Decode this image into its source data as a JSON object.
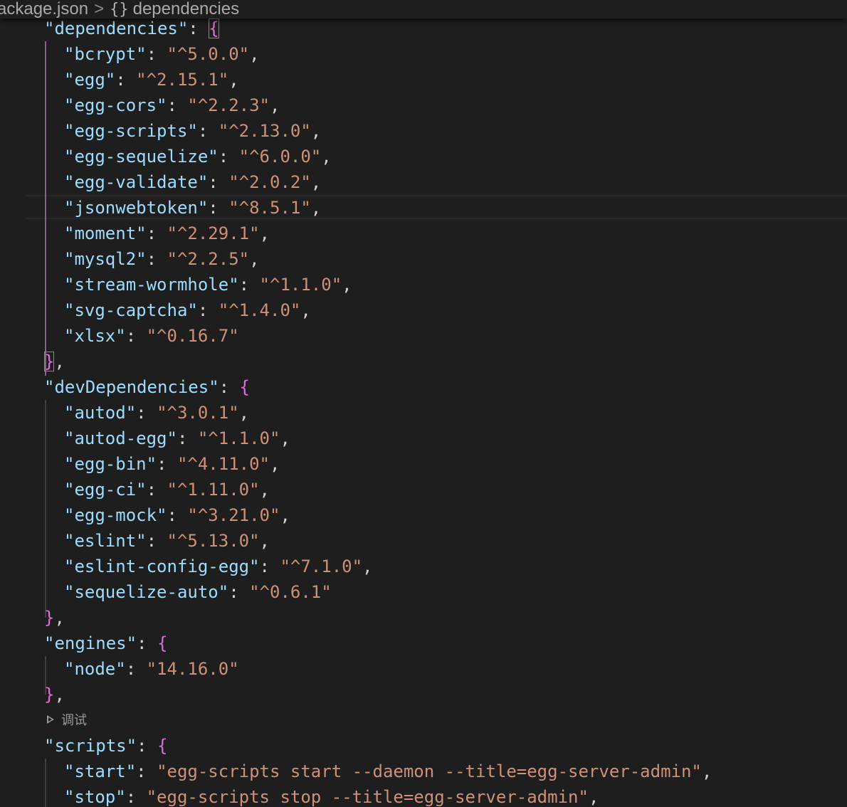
{
  "breadcrumb": {
    "file": "ackage.json",
    "separator": ">",
    "symbol_icon": "{}",
    "symbol": "dependencies"
  },
  "codelens": {
    "debug_label": "调试"
  },
  "code": {
    "dependencies_key": "\"dependencies\"",
    "dependencies": [
      {
        "key": "\"bcrypt\"",
        "value": "\"^5.0.0\"",
        "comma": ","
      },
      {
        "key": "\"egg\"",
        "value": "\"^2.15.1\"",
        "comma": ","
      },
      {
        "key": "\"egg-cors\"",
        "value": "\"^2.2.3\"",
        "comma": ","
      },
      {
        "key": "\"egg-scripts\"",
        "value": "\"^2.13.0\"",
        "comma": ","
      },
      {
        "key": "\"egg-sequelize\"",
        "value": "\"^6.0.0\"",
        "comma": ","
      },
      {
        "key": "\"egg-validate\"",
        "value": "\"^2.0.2\"",
        "comma": ","
      },
      {
        "key": "\"jsonwebtoken\"",
        "value": "\"^8.5.1\"",
        "comma": ","
      },
      {
        "key": "\"moment\"",
        "value": "\"^2.29.1\"",
        "comma": ","
      },
      {
        "key": "\"mysql2\"",
        "value": "\"^2.2.5\"",
        "comma": ","
      },
      {
        "key": "\"stream-wormhole\"",
        "value": "\"^1.1.0\"",
        "comma": ","
      },
      {
        "key": "\"svg-captcha\"",
        "value": "\"^1.4.0\"",
        "comma": ","
      },
      {
        "key": "\"xlsx\"",
        "value": "\"^0.16.7\"",
        "comma": ""
      }
    ],
    "devDependencies_key": "\"devDependencies\"",
    "devDependencies": [
      {
        "key": "\"autod\"",
        "value": "\"^3.0.1\"",
        "comma": ","
      },
      {
        "key": "\"autod-egg\"",
        "value": "\"^1.1.0\"",
        "comma": ","
      },
      {
        "key": "\"egg-bin\"",
        "value": "\"^4.11.0\"",
        "comma": ","
      },
      {
        "key": "\"egg-ci\"",
        "value": "\"^1.11.0\"",
        "comma": ","
      },
      {
        "key": "\"egg-mock\"",
        "value": "\"^3.21.0\"",
        "comma": ","
      },
      {
        "key": "\"eslint\"",
        "value": "\"^5.13.0\"",
        "comma": ","
      },
      {
        "key": "\"eslint-config-egg\"",
        "value": "\"^7.1.0\"",
        "comma": ","
      },
      {
        "key": "\"sequelize-auto\"",
        "value": "\"^0.6.1\"",
        "comma": ""
      }
    ],
    "engines_key": "\"engines\"",
    "engines": [
      {
        "key": "\"node\"",
        "value": "\"14.16.0\"",
        "comma": ""
      }
    ],
    "scripts_key": "\"scripts\"",
    "scripts": [
      {
        "key": "\"start\"",
        "value": "\"egg-scripts start --daemon --title=egg-server-admin\"",
        "comma": ","
      },
      {
        "key": "\"stop\"",
        "value": "\"egg-scripts stop --title=egg-server-admin\"",
        "comma": ","
      }
    ],
    "colon": ": ",
    "open_brace": "{",
    "close_brace": "}",
    "close_comma": ","
  },
  "colors": {
    "background": "#1e1e1e",
    "key": "#9cdcfe",
    "string": "#ce9178",
    "brace": "#da70d6",
    "punctuation": "#d4d4d4"
  }
}
